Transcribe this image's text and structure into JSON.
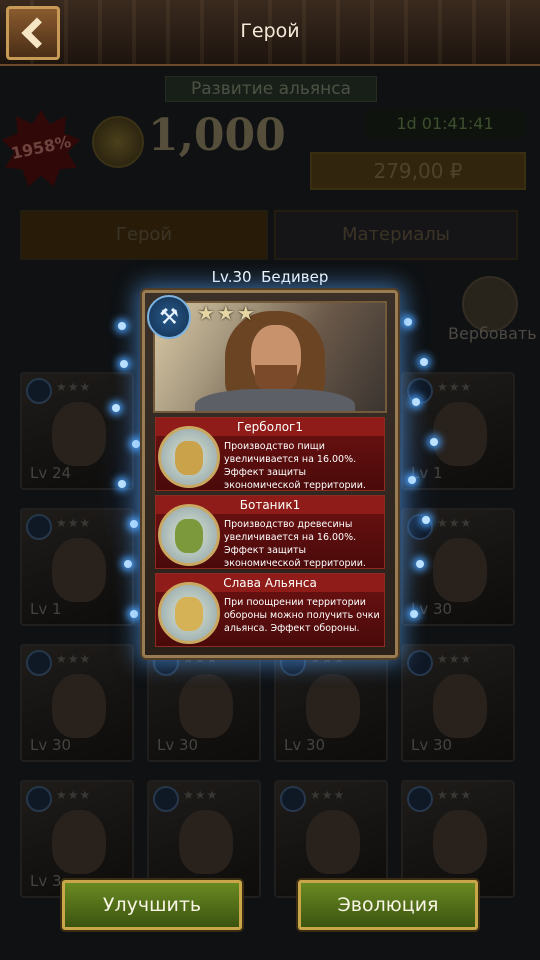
{
  "window": {
    "title": "Герой"
  },
  "promo": {
    "title": "Развитие альянса",
    "discount": "1958%",
    "amount": "1,000",
    "timer": "1d 01:41:41",
    "price": "279,00 ₽"
  },
  "tabs": [
    {
      "label": "Герой",
      "active": true
    },
    {
      "label": "Материалы",
      "active": false
    }
  ],
  "recruit_label": "Вербовать",
  "hero": {
    "level_text": "Lv.30",
    "name": "Бедивер",
    "stars": "★★★",
    "class_icon": "tools-icon",
    "skills": [
      {
        "name": "Герболог1",
        "description": "Производство пищи увеличивается на 16.00%. Эффект защиты экономической территории.",
        "icon": "wheat-emblem-icon",
        "color": "#c9a24a"
      },
      {
        "name": "Ботаник1",
        "description": "Производство древесины увеличивается на 16.00%. Эффект защиты экономической территории.",
        "icon": "tree-emblem-icon",
        "color": "#7c9a3c"
      },
      {
        "name": "Слава Альянса",
        "description": "При поощрении территории обороны можно получить очки альянса. Эффект обороны.",
        "icon": "shield-emblem-icon",
        "color": "#d6b257"
      }
    ]
  },
  "hero_list": {
    "cards": [
      {
        "level": "Lv 24"
      },
      {
        "level": ""
      },
      {
        "level": ""
      },
      {
        "level": "Lv 1"
      },
      {
        "level": "Lv 1"
      },
      {
        "level": ""
      },
      {
        "level": ""
      },
      {
        "level": "Lv 30"
      },
      {
        "level": "Lv 30"
      },
      {
        "level": "Lv 30"
      },
      {
        "level": "Lv 30"
      },
      {
        "level": "Lv 30"
      },
      {
        "level": "Lv 3"
      },
      {
        "level": ""
      },
      {
        "level": ""
      },
      {
        "level": ""
      }
    ]
  },
  "buttons": {
    "upgrade": "Улучшить",
    "evolve": "Эволюция"
  },
  "colors": {
    "accent_green": "#5a7a1a",
    "gold_border": "#c9a64a",
    "skill_red": "#6e1212",
    "glow_blue": "#4aa2ff"
  }
}
